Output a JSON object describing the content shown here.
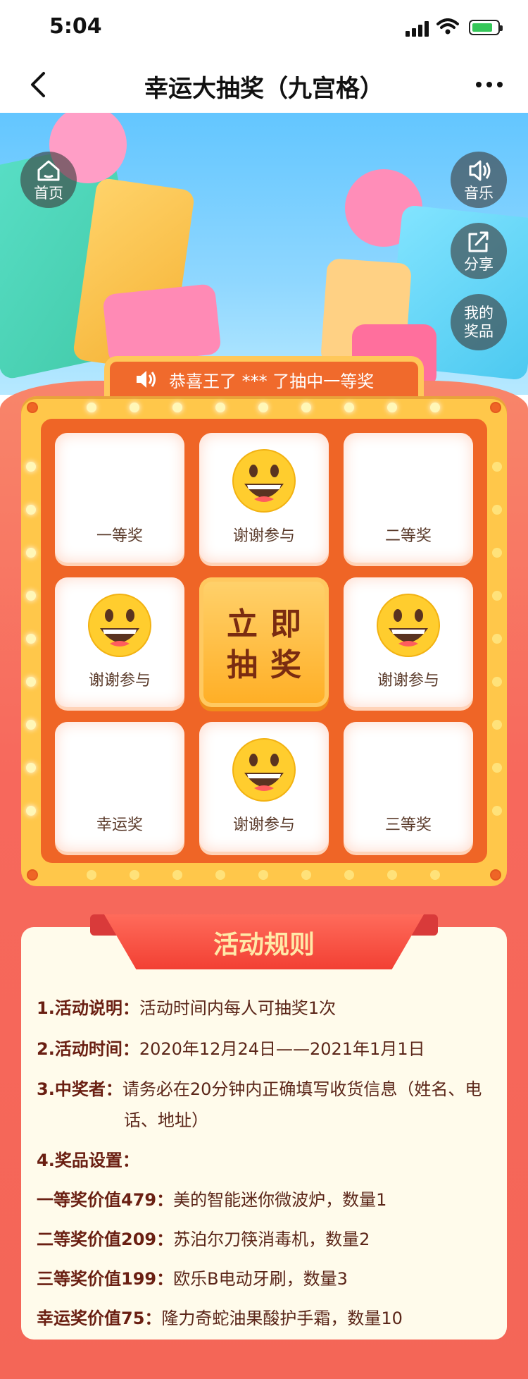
{
  "status": {
    "time": "5:04"
  },
  "nav": {
    "title": "幸运大抽奖（九宫格）"
  },
  "side": {
    "home": "首页",
    "music": "音乐",
    "share": "分享",
    "prizes_1": "我的",
    "prizes_2": "奖品"
  },
  "winner": {
    "text": "恭喜王了 *** 了抽中一等奖"
  },
  "grid": {
    "c1": "一等奖",
    "c2": "谢谢参与",
    "c3": "二等奖",
    "c4": "谢谢参与",
    "center_1": "立即",
    "center_2": "抽奖",
    "c6": "谢谢参与",
    "c7": "幸运奖",
    "c8": "谢谢参与",
    "c9": "三等奖"
  },
  "rules": {
    "title": "活动规则",
    "r1_k": "1.活动说明：",
    "r1_v": "活动时间内每人可抽奖1次",
    "r2_k": "2.活动时间：",
    "r2_v": "2020年12月24日——2021年1月1日",
    "r3_k": "3.中奖者：",
    "r3_v1": "请务必在20分钟内正确填写收货信息（姓名、电",
    "r3_v2": "话、地址）",
    "r4_k": "4.奖品设置：",
    "p1_k": "一等奖价值479：",
    "p1_v": "美的智能迷你微波炉，数量1",
    "p2_k": "二等奖价值209：",
    "p2_v": "苏泊尔刀筷消毒机，数量2",
    "p3_k": "三等奖价值199：",
    "p3_v": "欧乐B电动牙刷，数量3",
    "p4_k": "幸运奖价值75：",
    "p4_v": "隆力奇蛇油果酸护手霜，数量10"
  }
}
